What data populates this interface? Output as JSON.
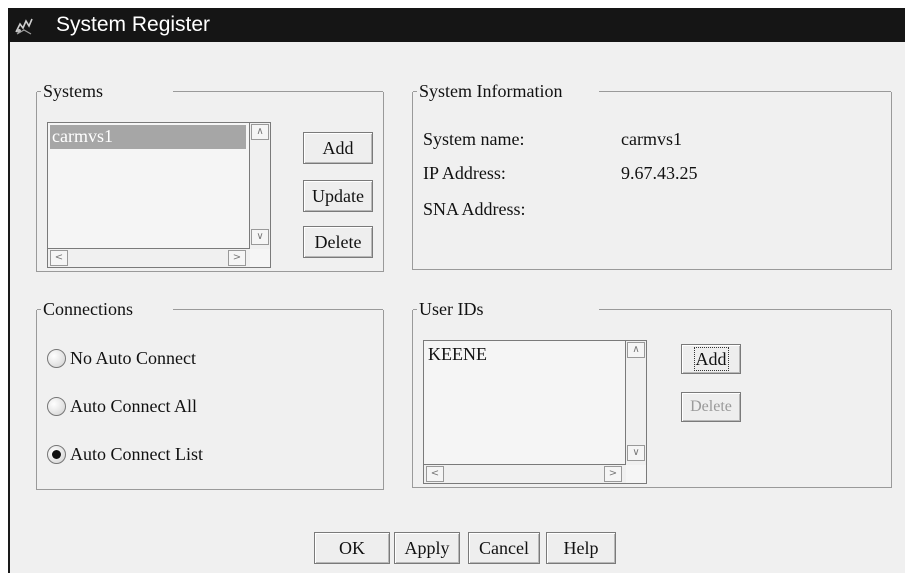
{
  "window": {
    "title": "System Register",
    "icon": "system-register-icon"
  },
  "systems": {
    "label": "Systems",
    "items": [
      {
        "label": "carmvs1",
        "selected": true
      }
    ],
    "buttons": {
      "add": "Add",
      "update": "Update",
      "delete": "Delete"
    }
  },
  "system_info": {
    "label": "System Information",
    "rows": [
      {
        "label": "System name:",
        "value": "carmvs1"
      },
      {
        "label": "IP Address:",
        "value": "9.67.43.25"
      },
      {
        "label": "SNA Address:",
        "value": ""
      }
    ]
  },
  "connections": {
    "label": "Connections",
    "options": [
      {
        "label": "No Auto Connect",
        "selected": false
      },
      {
        "label": "Auto Connect All",
        "selected": false
      },
      {
        "label": "Auto Connect List",
        "selected": true
      }
    ]
  },
  "user_ids": {
    "label": "User IDs",
    "items": [
      {
        "label": "KEENE"
      }
    ],
    "buttons": {
      "add": "Add",
      "delete": "Delete"
    }
  },
  "footer": {
    "ok": "OK",
    "apply": "Apply",
    "cancel": "Cancel",
    "help": "Help"
  }
}
